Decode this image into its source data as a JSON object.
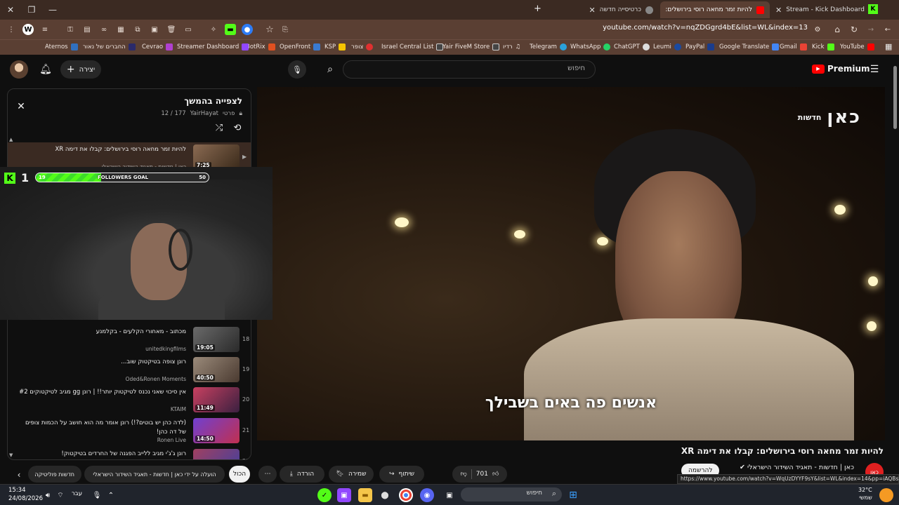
{
  "browser": {
    "tabs": [
      {
        "title": "Stream - Kick Dashboard",
        "favicon_color": "#53fc18",
        "active": false
      },
      {
        "title": "להיות זמר מחאה רוסי בירושלים:",
        "favicon_color": "#ff0000",
        "active": true
      },
      {
        "title": "כרטיסייה חדשה",
        "favicon_color": "#888888",
        "active": false
      }
    ],
    "new_tab": "+",
    "url": "youtube.com/watch?v=nqZDGgrd4bE&list=WL&index=13",
    "bookmarks": [
      "YouTube",
      "Kick",
      "Gmail",
      "Google Translate",
      "PayPal",
      "Leumi",
      "ChatGPT",
      "WhatsApp",
      "Telegram",
      "רדיו",
      "Yair FiveM Store",
      "Israel Central List",
      "צופר",
      "KSP",
      "OpenFront",
      "BotRix",
      "Streamer Dashboard",
      "Cevrao",
      "החברים של נאור",
      "Aternos"
    ]
  },
  "youtube": {
    "logo_text": "Premium",
    "search_placeholder": "חיפוש",
    "create_label": "יצירה",
    "video": {
      "subtitle": "אנשים פה באים בשבילך",
      "broadcaster_mark": "כאן",
      "broadcaster_sub": "חדשות",
      "title": "להיות זמר מחאה רוסי בירושלים: קבלו את דימה XR",
      "channel": "כאן | חדשות - תאגיד השידור הישראלי",
      "likes": "701",
      "actions": {
        "share": "שיתוף",
        "save": "שמירה",
        "download": "הורדה",
        "more": "⋯"
      },
      "subscribe": "להרשמה"
    },
    "chips": [
      "הכול",
      "הועלה על ידי כאן | חדשות - תאגיד השידור הישראלי",
      "חדשות פוליטיקה"
    ],
    "playlist": {
      "title": "לצפייה בהמשך",
      "privacy": "פרטי",
      "owner": "YairHayat",
      "position": "12 / 177",
      "items": [
        {
          "title": "להיות זמר מחאה רוסי בירושלים: קבלו את דימה XR",
          "channel": "כאן | חדשות - תאגיד השידור הישראלי",
          "duration": "7:25",
          "num": "▶"
        },
        {
          "title": "מכתוב - מאחורי הקלעים - בקלמנע",
          "channel": "unitedkingfilms",
          "duration": "19:05",
          "num": "18"
        },
        {
          "title": "רונן צופה בטיקטוק שוב...",
          "channel": "Oded&Ronen Moments",
          "duration": "40:50",
          "num": "19"
        },
        {
          "title": "אין סיכוי שאני נכנס לטיקטוק יותר!! | רונן gg מגיב לטיקטוקים #2",
          "channel": "KTAIM",
          "duration": "11:49",
          "num": "20"
        },
        {
          "title": "(לדה כהן יש בוטים?!) רונן אומר מה הוא חושב על הכמות צופים של דה כהן!",
          "channel": "Ronen Live",
          "duration": "14:50",
          "num": "21"
        },
        {
          "title": "רונן ג'ג'י מגיב ללייב הפגנה של החרדים בטיקטוק!",
          "channel": "",
          "duration": "",
          "num": "22"
        }
      ]
    },
    "status_url": "https://www.youtube.com/watch?v=WqUzDYYF9sY&list=WL&index=14&pp=iAQBsAgC"
  },
  "overlay": {
    "kick_count": "1",
    "goal_label": "FOLLOWERS GOAL",
    "goal_start": "19",
    "goal_end": "50",
    "goal_current": 19,
    "goal_max": 50
  },
  "taskbar": {
    "time": "15:34",
    "date": "24/08/2026",
    "language": "עבר",
    "search": "חיפוש",
    "temperature": "32°C",
    "weather": "שמשי"
  }
}
